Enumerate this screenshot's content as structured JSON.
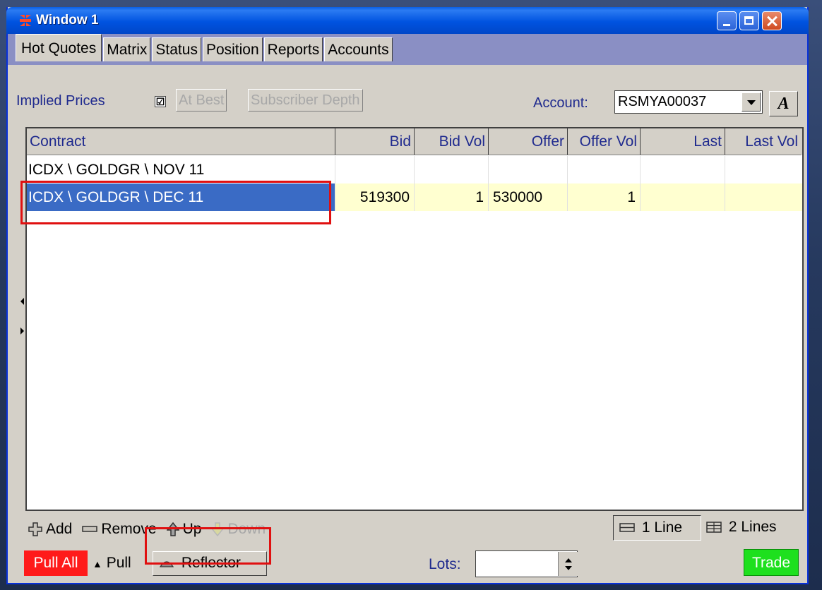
{
  "window": {
    "title": "Window 1"
  },
  "tabs": [
    "Hot Quotes",
    "Matrix",
    "Status",
    "Position",
    "Reports",
    "Accounts"
  ],
  "toolbar": {
    "implied_prices_label": "Implied Prices",
    "implied_checked": "☑",
    "at_best_label": "At Best",
    "subscriber_depth_label": "Subscriber Depth",
    "account_label": "Account:",
    "account_value": "RSMYA00037",
    "font_button_label": "A"
  },
  "grid": {
    "columns": [
      "Contract",
      "Bid",
      "Bid Vol",
      "Offer",
      "Offer Vol",
      "Last",
      "Last Vol"
    ],
    "rows": [
      {
        "contract": "ICDX \\ GOLDGR \\ NOV 11",
        "bid": "",
        "bid_vol": "",
        "offer": "",
        "offer_vol": "",
        "last": "",
        "last_vol": ""
      },
      {
        "contract": "ICDX \\ GOLDGR \\ DEC 11",
        "bid": "519300",
        "bid_vol": "1",
        "offer": "530000",
        "offer_vol": "1",
        "last": "",
        "last_vol": ""
      }
    ]
  },
  "bottom": {
    "add_label": "Add",
    "remove_label": "Remove",
    "up_label": "Up",
    "down_label": "Down",
    "one_line_label": "1 Line",
    "two_lines_label": "2 Lines",
    "pull_all_label": "Pull All",
    "pull_label": "Pull",
    "reflector_label": "Reflector",
    "lots_label": "Lots:",
    "lots_value": "",
    "trade_label": "Trade"
  },
  "colors": {
    "selected_row": "#3a6bc5",
    "row_highlight": "#ffffd0",
    "pull_all": "#ff1a1a",
    "trade": "#1ee01e",
    "annotation": "#e01010"
  }
}
